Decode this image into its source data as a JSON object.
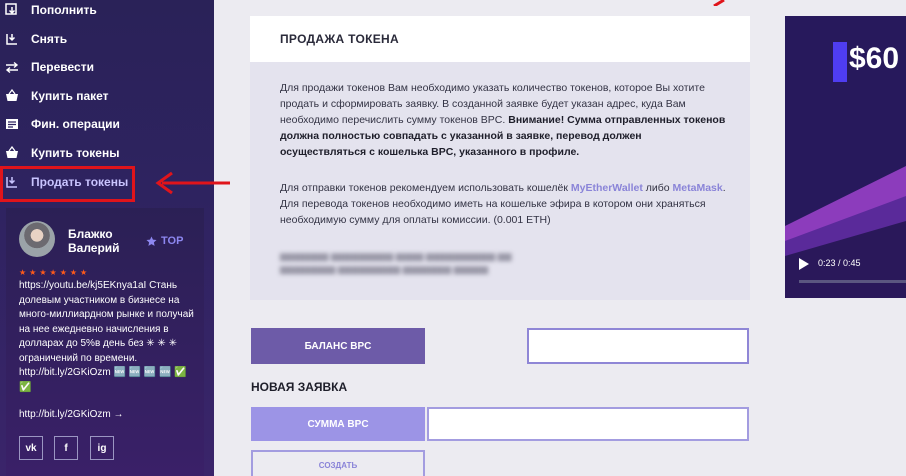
{
  "sidebar": {
    "items": [
      {
        "label": "Пополнить",
        "icon": "deposit-icon"
      },
      {
        "label": "Снять",
        "icon": "withdraw-icon"
      },
      {
        "label": "Перевести",
        "icon": "transfer-icon"
      },
      {
        "label": "Купить пакет",
        "icon": "basket-icon"
      },
      {
        "label": "Фин. операции",
        "icon": "list-icon"
      },
      {
        "label": "Купить токены",
        "icon": "basket-icon"
      },
      {
        "label": "Продать токены",
        "icon": "sell-icon"
      }
    ],
    "active_index": 6
  },
  "profile": {
    "name": "Блажко Валерий",
    "badge": "TOP",
    "stars": "★★★★★★★",
    "bio": "https://youtu.be/kj5EKnya1aI Стань долевым участником в бизнесе на много-миллиардном рынке и получай на нее ежедневно начисления в долларах до 5%в день без ✳ ✳ ✳ ограничений по времени. http://bit.ly/2GKiOzm 🆕 🆕 🆕 🆕 ✅ ✅",
    "link": "http://bit.ly/2GKiOzm →",
    "social": [
      "vk",
      "f",
      "ig"
    ]
  },
  "card": {
    "title": "ПРОДАЖА ТОКЕНА",
    "p1_normal": "Для продажи токенов Вам необходимо указать количество токенов, которое Вы хотите продать и сформировать заявку. В созданной заявке будет указан адрес, куда Вам необходимо перечислить сумму токенов BPC. ",
    "p1_bold": "Внимание! Сумма отправленных токенов должна полностью совпадать с указанной в заявке, перевод должен осуществляться с кошелька BPC, указанного в профиле.",
    "p2_a": "Для отправки токенов рекомендуем использовать кошелёк ",
    "p2_link1": "MyEtherWallet",
    "p2_b": " либо ",
    "p2_link2": "MetaMask",
    "p2_c": ". Для перевода токенов необходимо иметь на кошельке эфира в котором они храняться необходимую сумму для оплаты комиссии. (0.001 ETH)"
  },
  "balance": {
    "button": "БАЛАНС BPC",
    "value": ""
  },
  "new_request": {
    "title": "НОВАЯ ЗАЯВКА",
    "sum_label": "СУММА BPC",
    "sum_value": "",
    "create_button": "СОЗДАТЬ"
  },
  "video": {
    "title": "$60",
    "time": "0:23 / 0:45"
  },
  "colors": {
    "sidebar": "#2e2360",
    "accent": "#6d5ba8",
    "highlight": "#e0141b"
  }
}
